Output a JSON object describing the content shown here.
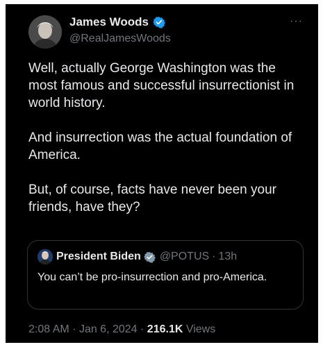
{
  "tweet": {
    "author_name": "James Woods",
    "author_handle": "@RealJamesWoods",
    "more_label": "···",
    "paragraphs": [
      "Well, actually George Washington was the most famous and successful insurrectionist in world history.",
      "And insurrection was the actual foundation of America.",
      "But, of course, facts have never been your friends, have they?"
    ],
    "quoted": {
      "author_name": "President Biden",
      "author_handle": "@POTUS",
      "separator": "·",
      "time": "13h",
      "text": "You can’t be pro-insurrection and pro-America."
    },
    "meta": {
      "time": "2:08 AM",
      "separator": "·",
      "date": "Jan 6, 2024",
      "separator2": "·",
      "views_count": "216.1K",
      "views_label": "Views"
    }
  },
  "colors": {
    "background": "#000000",
    "text": "#e7e9ea",
    "muted": "#71767b",
    "verified_badge": "#1d9bf0",
    "border": "#2f3336"
  },
  "icons": {
    "verified": "verified-badge-icon",
    "more": "more-options-icon"
  }
}
